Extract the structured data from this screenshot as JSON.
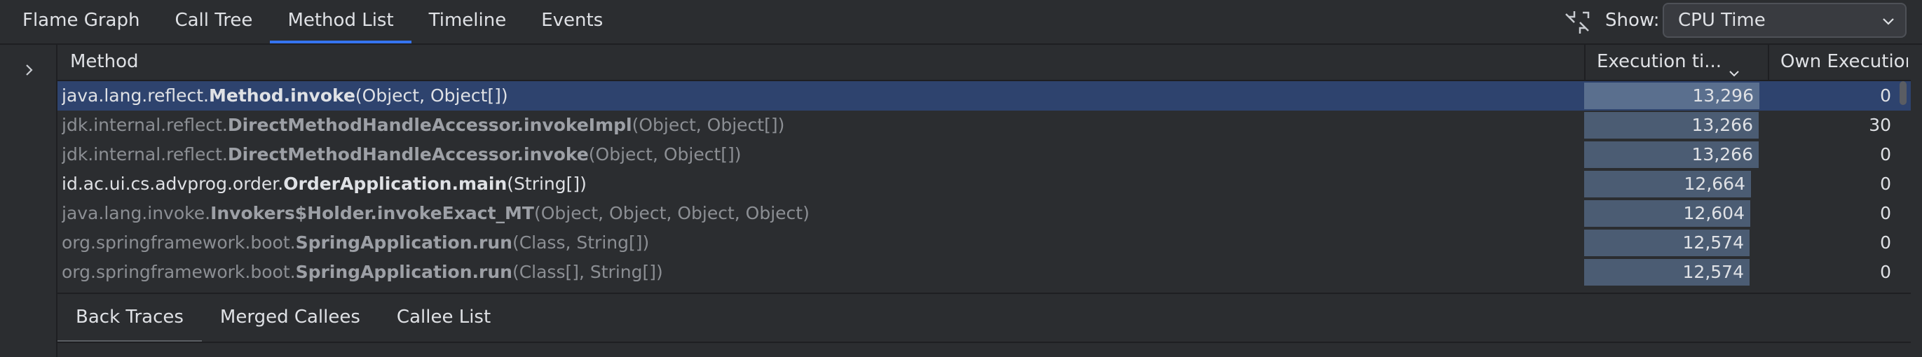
{
  "tabs": [
    "Flame Graph",
    "Call Tree",
    "Method List",
    "Timeline",
    "Events"
  ],
  "active_tab": "Method List",
  "show": {
    "label": "Show:",
    "value": "CPU Time"
  },
  "table": {
    "columns": {
      "method": "Method",
      "exec": "Execution ti...",
      "own": "Own Execution ..."
    },
    "rows": [
      {
        "pkg": "java.lang.reflect.",
        "cls": "Method.invoke",
        "args": "(Object, Object[])",
        "exec": "13,296",
        "own": "0",
        "selected": true,
        "dim": false
      },
      {
        "pkg": "jdk.internal.reflect.",
        "cls": "DirectMethodHandleAccessor.invokeImpl",
        "args": "(Object, Object[])",
        "exec": "13,266",
        "own": "30",
        "selected": false,
        "dim": true
      },
      {
        "pkg": "jdk.internal.reflect.",
        "cls": "DirectMethodHandleAccessor.invoke",
        "args": "(Object, Object[])",
        "exec": "13,266",
        "own": "0",
        "selected": false,
        "dim": true
      },
      {
        "pkg": "id.ac.ui.cs.advprog.order.",
        "cls": "OrderApplication.main",
        "args": "(String[])",
        "exec": "12,664",
        "own": "0",
        "selected": false,
        "dim": false
      },
      {
        "pkg": "java.lang.invoke.",
        "cls": "Invokers$Holder.invokeExact_MT",
        "args": "(Object, Object, Object, Object)",
        "exec": "12,604",
        "own": "0",
        "selected": false,
        "dim": true
      },
      {
        "pkg": "org.springframework.boot.",
        "cls": "SpringApplication.run",
        "args": "(Class, String[])",
        "exec": "12,574",
        "own": "0",
        "selected": false,
        "dim": true
      },
      {
        "pkg": "org.springframework.boot.",
        "cls": "SpringApplication.run",
        "args": "(Class[], String[])",
        "exec": "12,574",
        "own": "0",
        "selected": false,
        "dim": true
      }
    ],
    "exec_max": 13296
  },
  "bottom_tabs": [
    "Back Traces",
    "Merged Callees",
    "Callee List"
  ],
  "active_bottom_tab": "Back Traces",
  "icons": {
    "collapse": "collapse-arrows-icon",
    "dropdown": "chevron-down-icon",
    "expand": "chevron-right-icon",
    "sort": "sort-descending-icon"
  },
  "colors": {
    "accent": "#3574f0",
    "selected_row": "#2e436e",
    "bar": "#4b5c73"
  }
}
